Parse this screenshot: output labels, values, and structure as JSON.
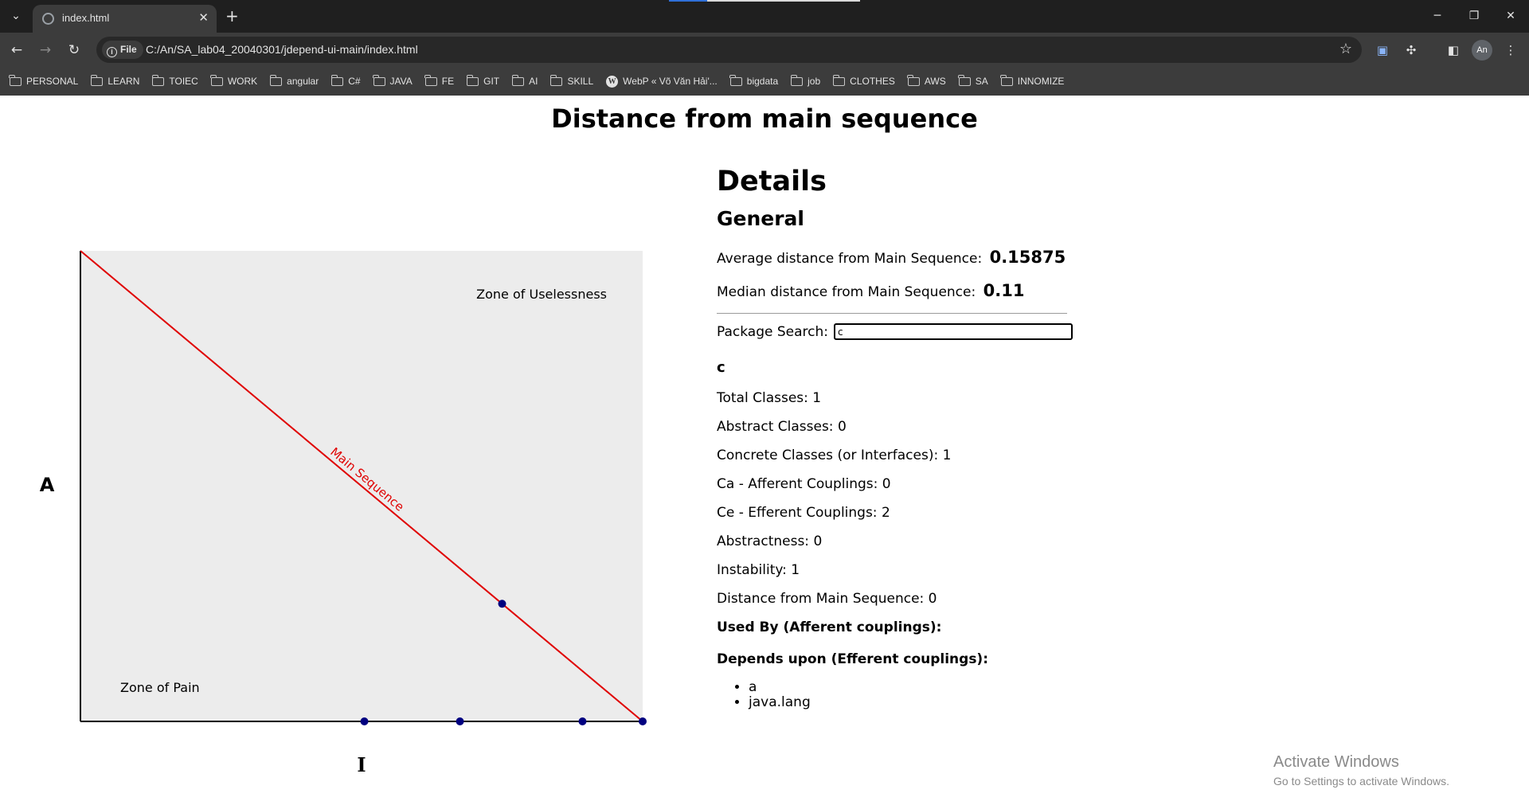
{
  "browser": {
    "tab_title": "index.html",
    "site_chip": "File",
    "url": "C:/An/SA_lab04_20040301/jdepend-ui-main/index.html",
    "avatar_initials": "An",
    "bookmarks": [
      {
        "label": "PERSONAL",
        "icon": "folder-icon"
      },
      {
        "label": "LEARN",
        "icon": "folder-icon"
      },
      {
        "label": "TOIEC",
        "icon": "folder-icon"
      },
      {
        "label": "WORK",
        "icon": "folder-icon"
      },
      {
        "label": "angular",
        "icon": "folder-icon"
      },
      {
        "label": "C#",
        "icon": "folder-icon"
      },
      {
        "label": "JAVA",
        "icon": "folder-icon"
      },
      {
        "label": "FE",
        "icon": "folder-icon"
      },
      {
        "label": "GIT",
        "icon": "folder-icon"
      },
      {
        "label": "AI",
        "icon": "folder-icon"
      },
      {
        "label": "SKILL",
        "icon": "folder-icon"
      },
      {
        "label": "WebP « Võ Văn Hải'...",
        "icon": "wordpress-icon"
      },
      {
        "label": "bigdata",
        "icon": "folder-icon"
      },
      {
        "label": "job",
        "icon": "folder-icon"
      },
      {
        "label": "CLOTHES",
        "icon": "folder-icon"
      },
      {
        "label": "AWS",
        "icon": "folder-icon"
      },
      {
        "label": "SA",
        "icon": "folder-icon"
      },
      {
        "label": "INNOMIZE",
        "icon": "folder-icon"
      }
    ]
  },
  "page": {
    "title": "Distance from main sequence"
  },
  "chart_data": {
    "type": "scatter",
    "xlabel": "I",
    "ylabel": "A",
    "xlim": [
      0,
      1
    ],
    "ylim": [
      0,
      1
    ],
    "main_sequence_label": "Main Sequence",
    "zone_uselessness_label": "Zone of Uselessness",
    "zone_pain_label": "Zone of Pain",
    "line_color": "#e00000",
    "point_color": "#000080",
    "background_color": "#ececec",
    "points": [
      {
        "x": 0.505,
        "y": 0
      },
      {
        "x": 0.675,
        "y": 0
      },
      {
        "x": 0.893,
        "y": 0
      },
      {
        "x": 1.0,
        "y": 0
      },
      {
        "x": 0.75,
        "y": 0.25
      }
    ]
  },
  "details": {
    "heading": "Details",
    "general_heading": "General",
    "avg_label": "Average distance from Main Sequence:",
    "avg_value": "0.15875",
    "median_label": "Median distance from Main Sequence:",
    "median_value": "0.11",
    "search_label": "Package Search:",
    "search_value": "c",
    "package": {
      "name": "c",
      "total_classes": "Total Classes: 1",
      "abstract_classes": "Abstract Classes: 0",
      "concrete_classes": "Concrete Classes (or Interfaces): 1",
      "ca": "Ca - Afferent Couplings: 0",
      "ce": "Ce - Efferent Couplings: 2",
      "abstractness": "Abstractness: 0",
      "instability": "Instability: 1",
      "distance": "Distance from Main Sequence: 0",
      "used_by_label": "Used By (Afferent couplings):",
      "depends_label": "Depends upon (Efferent couplings):",
      "depends": [
        "a",
        "java.lang"
      ]
    }
  },
  "watermark": {
    "line1": "Activate Windows",
    "line2": "Go to Settings to activate Windows."
  }
}
